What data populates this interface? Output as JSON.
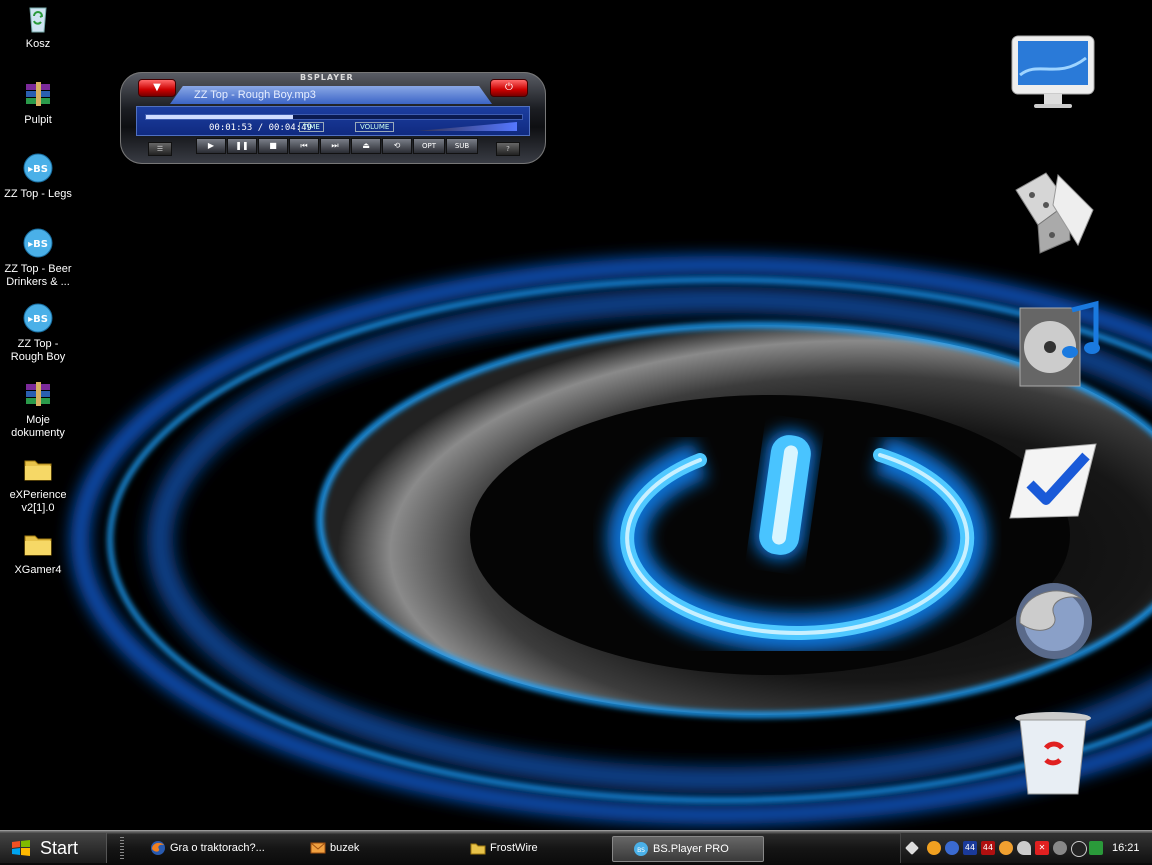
{
  "desktop": {
    "icons": [
      {
        "label": "Kosz",
        "type": "recycle"
      },
      {
        "label": "Pulpit",
        "type": "rar"
      },
      {
        "label": "ZZ Top - Legs",
        "type": "bs"
      },
      {
        "label": "ZZ Top - Beer Drinkers & ...",
        "type": "bs"
      },
      {
        "label": "ZZ Top - Rough Boy",
        "type": "bs"
      },
      {
        "label": "Moje dokumenty",
        "type": "rar"
      },
      {
        "label": "eXPerience v2[1].0",
        "type": "folder"
      },
      {
        "label": "XGamer4",
        "type": "folder"
      }
    ],
    "dock_icons": [
      "imac-icon",
      "games-dice-icon",
      "music-cd-icon",
      "checkmark-task-icon",
      "firefox-icon",
      "recycle-bin-icon"
    ]
  },
  "bsplayer": {
    "brand": "BSPLAYER",
    "now_playing": "ZZ Top - Rough Boy.mp3",
    "time": "00:01:53 / 00:04:49",
    "time_label": "TIME",
    "volume_label": "VOLUME",
    "progress": 0.39,
    "controls": [
      "▶",
      "❚❚",
      "■",
      "⏮",
      "⏭",
      "⏏",
      "⟲",
      "OPT",
      "SUB"
    ]
  },
  "taskbar": {
    "start_label": "Start",
    "tasks": [
      {
        "label": "Gra o traktorach?...",
        "icon": "firefox-icon",
        "active": false
      },
      {
        "label": "buzek",
        "icon": "mail-icon",
        "active": false
      },
      {
        "label": "FrostWire",
        "icon": "folder-icon",
        "active": false
      },
      {
        "label": "BS.Player PRO",
        "icon": "bsplayer-icon",
        "active": true
      }
    ],
    "tray_badges": [
      "44",
      "44"
    ],
    "clock": "16:21"
  },
  "colors": {
    "glow": "#1aa3ff",
    "bs_blue": "#1c3ea0",
    "bs_red": "#cc0000"
  }
}
